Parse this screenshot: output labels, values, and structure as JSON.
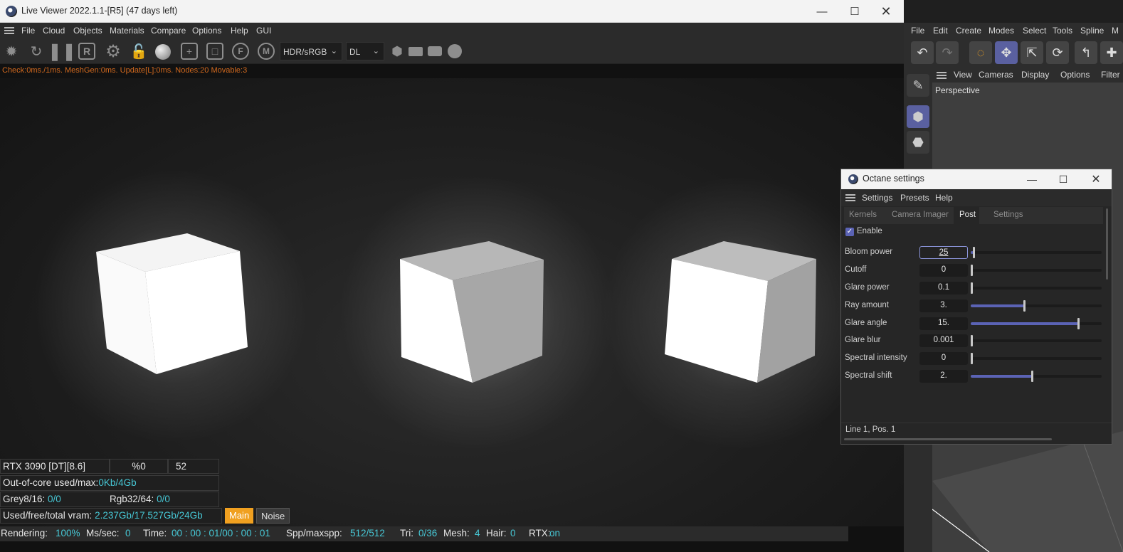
{
  "live_viewer": {
    "title": "Live Viewer 2022.1.1-[R5] (47 days left)",
    "menu": [
      "File",
      "Cloud",
      "Objects",
      "Materials",
      "Compare",
      "Options",
      "Help",
      "GUI"
    ],
    "toolbar": {
      "r_label": "R",
      "f_label": "F",
      "m_label": "M",
      "colorspace": "HDR/sRGB",
      "kernel": "DL"
    },
    "stats_line": "Check:0ms./1ms. MeshGen:0ms. Update[L]:0ms. Nodes:20 Movable:3",
    "gpu_info": {
      "gpu": "RTX 3090 [DT][8.6]",
      "percent": "%0",
      "temp": "52",
      "out_of_core_label": "Out-of-core used/max:",
      "out_of_core_value": "0Kb/4Gb",
      "grey_label": "Grey8/16:",
      "grey_value": "0/0",
      "rgb_label": "Rgb32/64:",
      "rgb_value": "0/0",
      "vram_label": "Used/free/total vram:",
      "vram_value": "2.237Gb/17.527Gb/24Gb",
      "main_tag": "Main",
      "noise_tag": "Noise"
    },
    "status": {
      "rendering_label": "Rendering:",
      "rendering_value": "100%",
      "mssec_label": "Ms/sec:",
      "mssec_value": "0",
      "time_label": "Time:",
      "time_value": "00 : 00 : 01/00 : 00 : 01",
      "spp_label": "Spp/maxspp:",
      "spp_value": "512/512",
      "tri_label": "Tri:",
      "tri_value": "0/36",
      "mesh_label": "Mesh:",
      "mesh_value": "4",
      "hair_label": "Hair:",
      "hair_value": "0",
      "rtx_label": "RTX:",
      "rtx_value": "on"
    }
  },
  "c4d": {
    "menu": [
      "File",
      "Edit",
      "Create",
      "Modes",
      "Select",
      "Tools",
      "Spline",
      "M"
    ],
    "view_menu": [
      "View",
      "Cameras",
      "Display",
      "Options",
      "Filter"
    ],
    "viewport_label": "Perspective"
  },
  "octane": {
    "title": "Octane settings",
    "menu": [
      "Settings",
      "Presets",
      "Help"
    ],
    "tabs": [
      "Kernels",
      "Camera Imager",
      "Post",
      "Settings"
    ],
    "enable_label": "Enable",
    "params": [
      {
        "label": "Bloom power",
        "value": "25",
        "fill": 0.02
      },
      {
        "label": "Cutoff",
        "value": "0",
        "fill": 0.0
      },
      {
        "label": "Glare power",
        "value": "0.1",
        "fill": 0.0
      },
      {
        "label": "Ray amount",
        "value": "3.",
        "fill": 0.41
      },
      {
        "label": "Glare angle",
        "value": "15.",
        "fill": 0.82
      },
      {
        "label": "Glare blur",
        "value": "0.001",
        "fill": 0.0
      },
      {
        "label": "Spectral intensity",
        "value": "0",
        "fill": 0.0
      },
      {
        "label": "Spectral shift",
        "value": "2.",
        "fill": 0.47
      }
    ],
    "status_line": "Line 1, Pos. 1"
  }
}
